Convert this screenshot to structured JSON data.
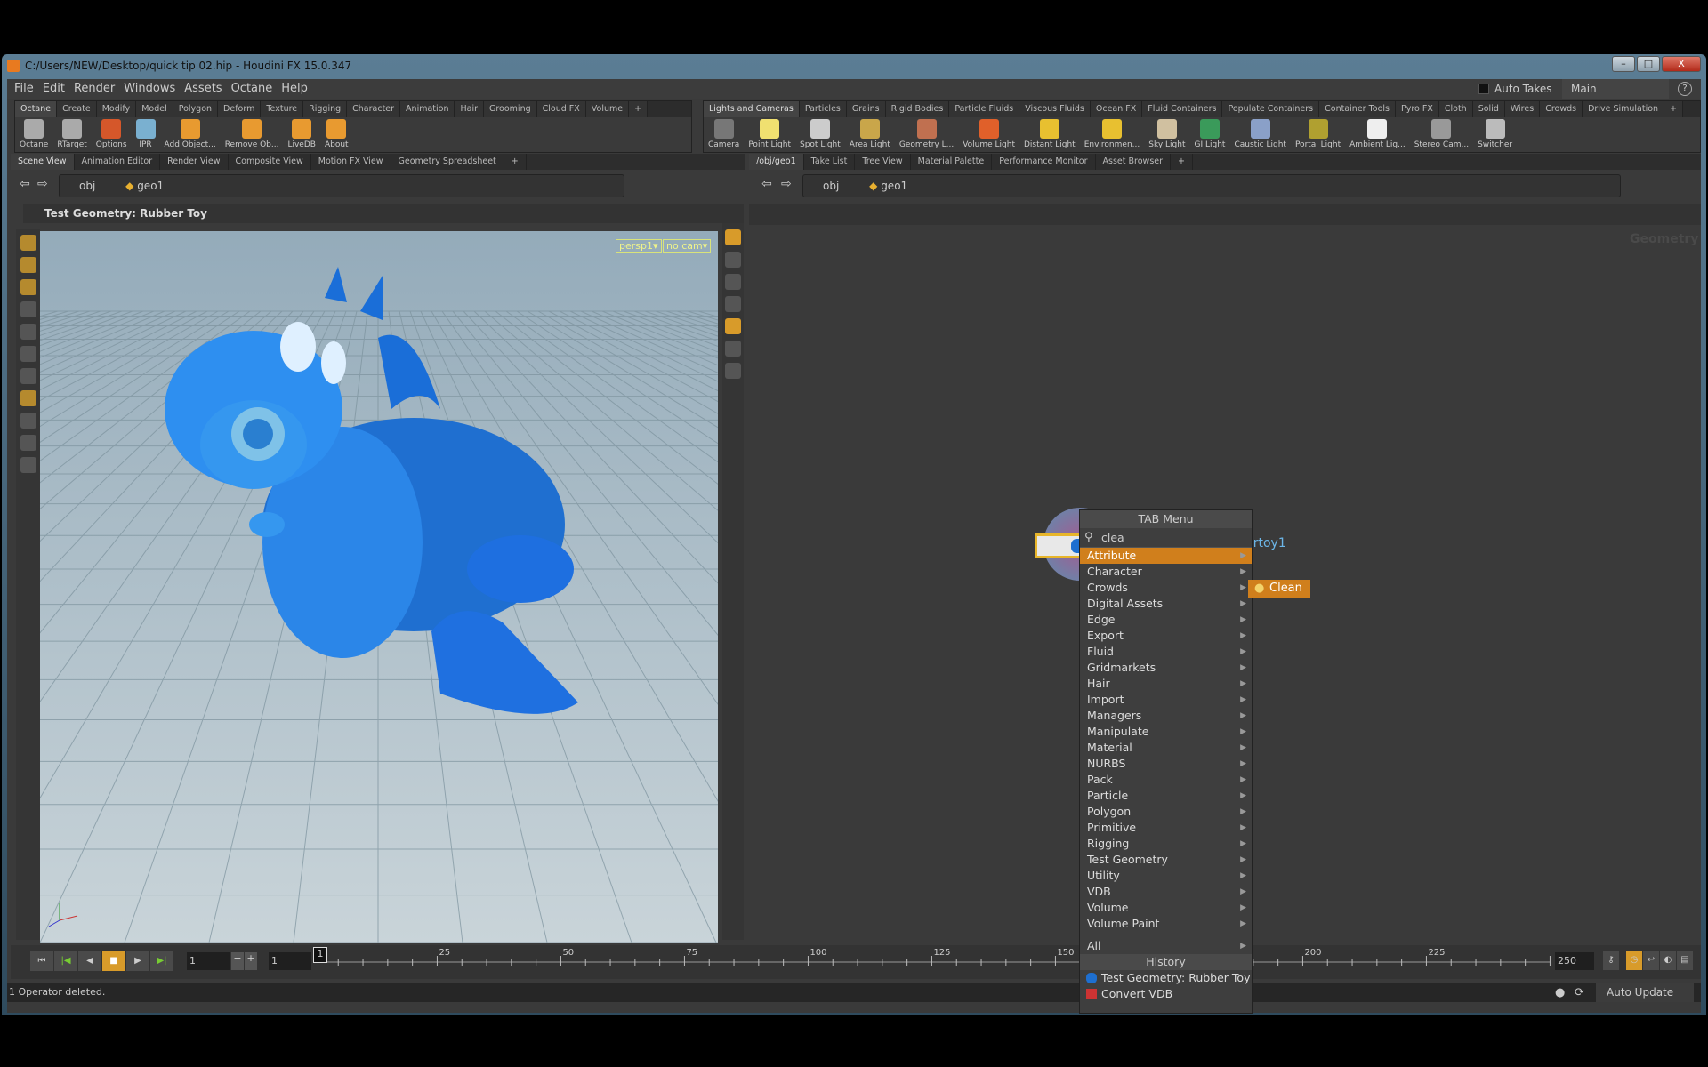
{
  "window": {
    "title": "C:/Users/NEW/Desktop/quick tip 02.hip - Houdini FX 15.0.347",
    "min": "–",
    "max": "□",
    "close": "X"
  },
  "menu": [
    "File",
    "Edit",
    "Render",
    "Windows",
    "Assets",
    "Octane",
    "Help"
  ],
  "top_right": {
    "auto_takes": "Auto Takes",
    "desktop": "Main",
    "help": "?"
  },
  "left_shelf": {
    "tabs": [
      "Octane",
      "Create",
      "Modify",
      "Model",
      "Polygon",
      "Deform",
      "Texture",
      "Rigging",
      "Character",
      "Animation",
      "Hair",
      "Grooming",
      "Cloud FX",
      "Volume",
      "+"
    ],
    "tools": [
      "Octane",
      "RTarget",
      "Options",
      "IPR",
      "Add Object...",
      "Remove Ob...",
      "LiveDB",
      "About"
    ]
  },
  "right_shelf": {
    "tabs": [
      "Lights and Cameras",
      "Particles",
      "Grains",
      "Rigid Bodies",
      "Particle Fluids",
      "Viscous Fluids",
      "Ocean FX",
      "Fluid Containers",
      "Populate Containers",
      "Container Tools",
      "Pyro FX",
      "Cloth",
      "Solid",
      "Wires",
      "Crowds",
      "Drive Simulation",
      "+"
    ],
    "tools": [
      "Camera",
      "Point Light",
      "Spot Light",
      "Area Light",
      "Geometry L...",
      "Volume Light",
      "Distant Light",
      "Environmen...",
      "Sky Light",
      "GI Light",
      "Caustic Light",
      "Portal Light",
      "Ambient Lig...",
      "Stereo Cam...",
      "Switcher"
    ]
  },
  "left_pane": {
    "tabs": [
      "Scene View",
      "Animation Editor",
      "Render View",
      "Composite View",
      "Motion FX View",
      "Geometry Spreadsheet",
      "+"
    ],
    "path": [
      "obj",
      "geo1"
    ],
    "header": "Test Geometry: Rubber Toy",
    "persp": "persp1▾",
    "cam": "no cam▾"
  },
  "right_pane": {
    "tabs": [
      "/obj/geo1",
      "Take List",
      "Tree View",
      "Material Palette",
      "Performance Monitor",
      "Asset Browser",
      "+"
    ],
    "path": [
      "obj",
      "geo1"
    ],
    "watermark": "Geometry",
    "node": {
      "name": "testgeometry_rubbertoy1",
      "color": "#2aa8ff"
    }
  },
  "tab_menu": {
    "title": "TAB Menu",
    "search": "clea",
    "clean_button": "Clean",
    "items": [
      "Attribute",
      "Character",
      "Crowds",
      "Digital Assets",
      "Edge",
      "Export",
      "Fluid",
      "Gridmarkets",
      "Hair",
      "Import",
      "Managers",
      "Manipulate",
      "Material",
      "NURBS",
      "Pack",
      "Particle",
      "Polygon",
      "Primitive",
      "Rigging",
      "Test Geometry",
      "Utility",
      "VDB",
      "Volume",
      "Volume Paint"
    ],
    "highlighted": "Attribute",
    "all": "All",
    "history_title": "History",
    "history": [
      "Test Geometry: Rubber Toy",
      "Convert VDB"
    ],
    "accent": "#d07f1c"
  },
  "timeline": {
    "frame": "1",
    "start": "1",
    "end_start": "1",
    "end": "250",
    "current": "1",
    "ticks": [
      "25",
      "50",
      "75",
      "100",
      "125",
      "150",
      "200",
      "225"
    ]
  },
  "status": {
    "message": "1 Operator deleted.",
    "update": "Auto Update"
  }
}
